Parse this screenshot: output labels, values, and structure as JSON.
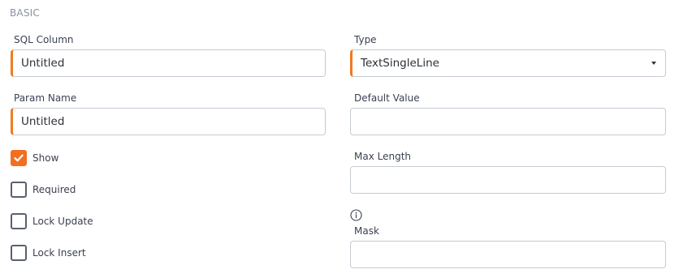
{
  "section": {
    "title": "BASIC"
  },
  "fields": {
    "sql_column": {
      "label": "SQL Column",
      "value": "Untitled"
    },
    "type": {
      "label": "Type",
      "value": "TextSingleLine"
    },
    "param_name": {
      "label": "Param Name",
      "value": "Untitled"
    },
    "default_value": {
      "label": "Default Value",
      "value": ""
    },
    "max_length": {
      "label": "Max Length",
      "value": ""
    },
    "mask": {
      "label": "Mask",
      "value": ""
    }
  },
  "checkboxes": {
    "show": {
      "label": "Show",
      "checked": true
    },
    "required": {
      "label": "Required",
      "checked": false
    },
    "lock_update": {
      "label": "Lock Update",
      "checked": false
    },
    "lock_insert": {
      "label": "Lock Insert",
      "checked": false
    }
  },
  "icons": {
    "info": "info-circle-icon",
    "caret": "caret-down-icon",
    "check": "checkmark-icon"
  },
  "colors": {
    "accent": "#f26f21",
    "required_marker": "#f07a22",
    "border": "#c5cad3",
    "section_title": "#8a92a3"
  }
}
